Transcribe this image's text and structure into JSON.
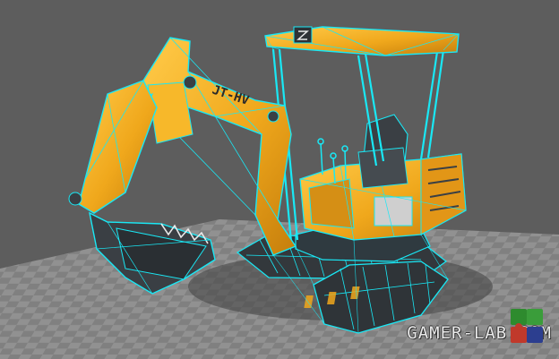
{
  "scene": {
    "subject": "excavator-3d-model",
    "background_color": "#5d5d5d",
    "grid_floor_color": "#9a9a9a",
    "grid_line_color": "#7c7c7c",
    "wireframe_color": "#19e8f5",
    "body_color": "#f0a81c",
    "dark_part_color": "#3a3f44"
  },
  "boom_decal": "JT-HV",
  "watermark": {
    "text": "GAMER-LAB.COM",
    "logo_icon": "puzzle-logo-icon"
  }
}
